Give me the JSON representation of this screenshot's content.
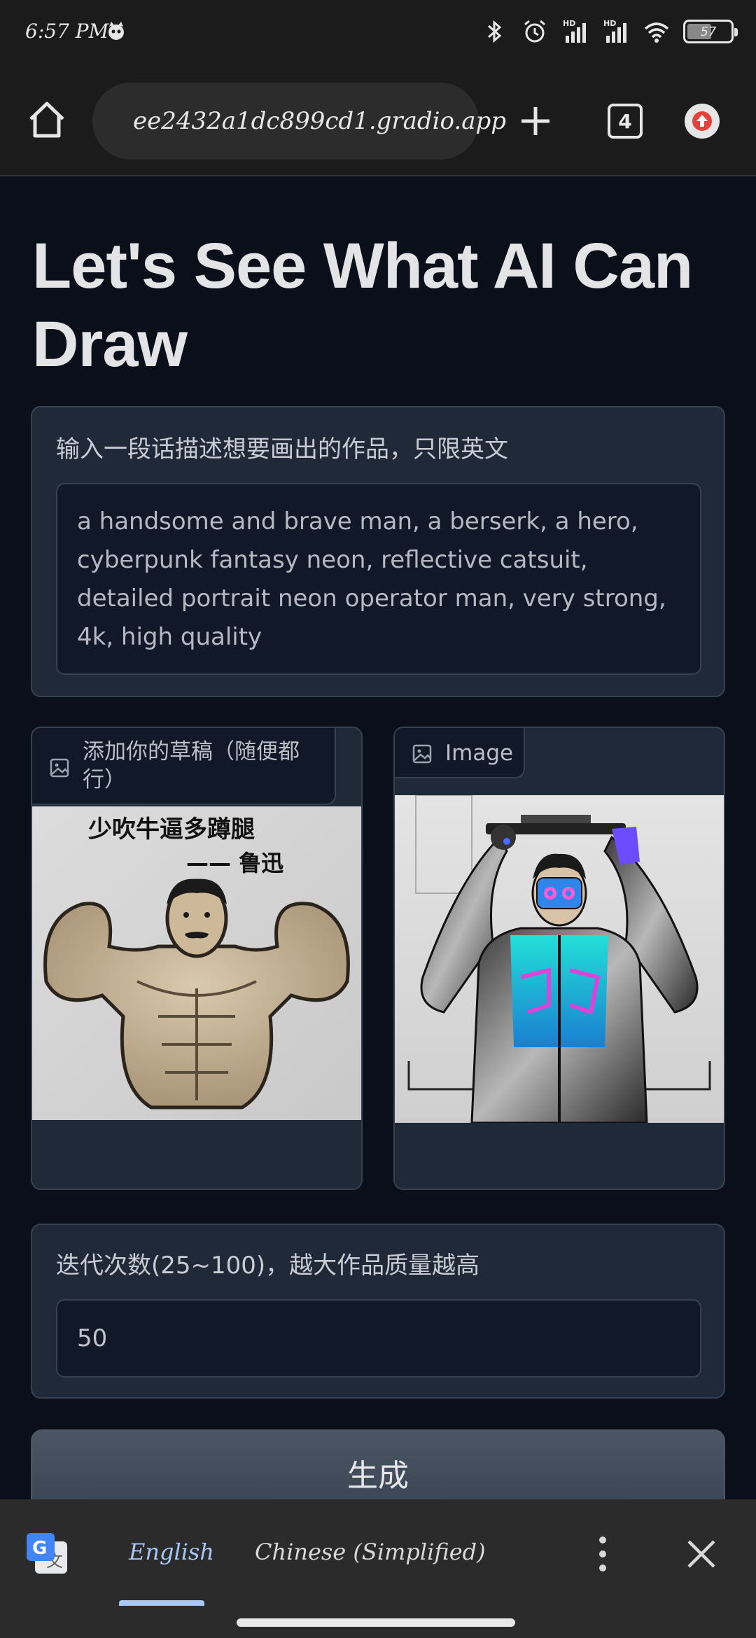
{
  "status_bar": {
    "time": "6:57 PM",
    "battery_level": "57",
    "battery_fraction": 0.57,
    "icons": [
      "cat-notification-icon",
      "bluetooth-icon",
      "alarm-icon",
      "hd-signal-icon",
      "hd-signal-icon",
      "wifi-icon",
      "battery-icon"
    ]
  },
  "browser": {
    "url": "ee2432a1dc899cd1.gradio.app",
    "tab_count": "4",
    "icons": [
      "home-icon",
      "lock-icon",
      "plus-icon",
      "tabs-icon",
      "update-icon"
    ]
  },
  "page": {
    "title": "Let's See What AI Can Draw",
    "prompt": {
      "label": "输入一段话描述想要画出的作品，只限英文",
      "value": "a handsome and brave man, a berserk, a hero, cyberpunk  fantasy neon, reflective catsuit, detailed portrait neon operator man, very strong, 4k, high quality"
    },
    "sketch": {
      "label": "添加你的草稿（随便都行）",
      "image_caption_line1": "少吹牛逼多蹲腿",
      "image_caption_line2": "—— 鲁迅"
    },
    "output": {
      "label": "Image"
    },
    "steps": {
      "label": "迭代次数(25~100)，越大作品质量越高",
      "value": "50"
    },
    "generate_label": "生成"
  },
  "translate_bar": {
    "source_language": "English",
    "target_language": "Chinese (Simplified)"
  },
  "colors": {
    "page_bg": "#0b0f19",
    "panel_bg": "#1f2937",
    "field_bg": "#111827",
    "border": "#374151",
    "translate_accent": "#a9c7f5"
  }
}
